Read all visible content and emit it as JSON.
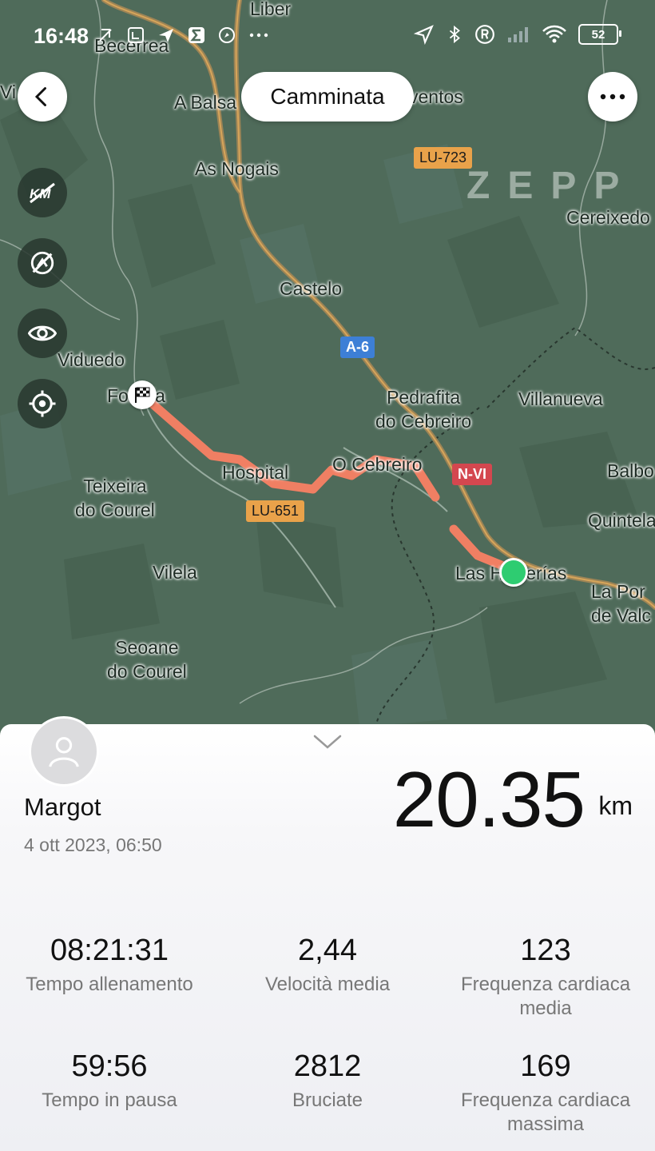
{
  "status_bar": {
    "time": "16:48",
    "battery": "52"
  },
  "header": {
    "activity_title": "Camminata",
    "watermark": "ZEPP"
  },
  "map": {
    "places": [
      {
        "key": "liber",
        "label": "Liber"
      },
      {
        "key": "becerrea",
        "label": "Becerrea"
      },
      {
        "key": "vi",
        "label": "Vi"
      },
      {
        "key": "abalsa",
        "label": "A Balsa"
      },
      {
        "key": "ventos",
        "label": "ventos"
      },
      {
        "key": "asnogais",
        "label": "As Nogais"
      },
      {
        "key": "cereixedo",
        "label": "Cereixedo"
      },
      {
        "key": "castelo",
        "label": "Castelo"
      },
      {
        "key": "viduedo",
        "label": "Viduedo"
      },
      {
        "key": "fonfria",
        "label": "Fonfría"
      },
      {
        "key": "pedrafita",
        "label": "Pedrafita\ndo Cebreiro"
      },
      {
        "key": "villanueva",
        "label": "Villanueva"
      },
      {
        "key": "hospital",
        "label": "Hospital"
      },
      {
        "key": "ocebreiro",
        "label": "O Cebreiro"
      },
      {
        "key": "teixeira",
        "label": "Teixeira\ndo Courel"
      },
      {
        "key": "balbo",
        "label": "Balbo"
      },
      {
        "key": "quintela",
        "label": "Quintela"
      },
      {
        "key": "vilela",
        "label": "Vilela"
      },
      {
        "key": "lasherrerias",
        "label": "Las Herrerías"
      },
      {
        "key": "laporte",
        "label": "La Por\nde Valc"
      },
      {
        "key": "seoane",
        "label": "Seoane\ndo Courel"
      }
    ],
    "road_labels": {
      "lu723": "LU-723",
      "a6": "A-6",
      "nvi": "N-VI",
      "lu651": "LU-651"
    },
    "route_color": "#f07f63",
    "end_marker_color": "#2ecc71"
  },
  "summary": {
    "user_name": "Margot",
    "date": "4 ott 2023, 06:50",
    "distance": "20.35",
    "distance_unit": "km"
  },
  "stats": [
    {
      "value": "08:21:31",
      "label": "Tempo allenamento"
    },
    {
      "value": "2,44",
      "label": "Velocità media"
    },
    {
      "value": "123",
      "label": "Frequenza cardiaca\nmedia"
    },
    {
      "value": "59:56",
      "label": "Tempo in pausa"
    },
    {
      "value": "2812",
      "label": "Bruciate"
    },
    {
      "value": "169",
      "label": "Frequenza cardiaca\nmassima"
    }
  ]
}
